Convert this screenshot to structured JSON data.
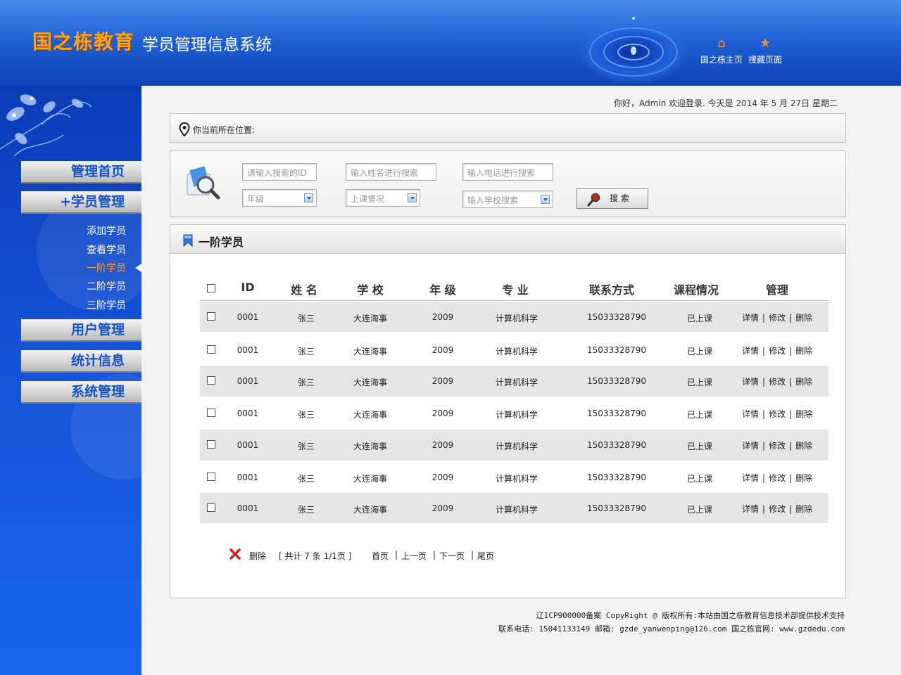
{
  "header": {
    "logo": "国之栋教育",
    "system_title": "学员管理信息系统",
    "links": [
      {
        "label": "国之栋主页",
        "icon": "home-icon"
      },
      {
        "label": "搜藏页面",
        "icon": "star-icon"
      }
    ]
  },
  "sidebar": {
    "menus": [
      {
        "label": "管理首页"
      },
      {
        "label": "+学员管理"
      },
      {
        "label": "用户管理"
      },
      {
        "label": "统计信息"
      },
      {
        "label": "系统管理"
      }
    ],
    "sub_items": [
      {
        "label": "添加学员",
        "active": false
      },
      {
        "label": "查看学员",
        "active": false
      },
      {
        "label": "一阶学员",
        "active": true
      },
      {
        "label": "二阶学员",
        "active": false
      },
      {
        "label": "三阶学员",
        "active": false
      }
    ]
  },
  "greeting": "你好，Admin 欢迎登录. 今天是  2014 年 5 月 27日 星期二",
  "location": {
    "label": "你当前所在位置:"
  },
  "search": {
    "id_placeholder": "请输入搜索的ID",
    "name_placeholder": "输入姓名进行搜索",
    "phone_placeholder": "输入电话进行搜索",
    "grade_select": "年级",
    "class_select": "上课情况",
    "school_select": "输入学校搜索",
    "button_label": "搜 索"
  },
  "list": {
    "title": "一阶学员",
    "columns": [
      "ID",
      "姓 名",
      "学 校",
      "年 级",
      "专 业",
      "联系方式",
      "课程情况",
      "管理"
    ],
    "rows": [
      {
        "id": "0001",
        "name": "张三",
        "school": "大连海事",
        "grade": "2009",
        "major": "计算机科学",
        "phone": "15033328790",
        "status": "已上课"
      },
      {
        "id": "0001",
        "name": "张三",
        "school": "大连海事",
        "grade": "2009",
        "major": "计算机科学",
        "phone": "15033328790",
        "status": "已上课"
      },
      {
        "id": "0001",
        "name": "张三",
        "school": "大连海事",
        "grade": "2009",
        "major": "计算机科学",
        "phone": "15033328790",
        "status": "已上课"
      },
      {
        "id": "0001",
        "name": "张三",
        "school": "大连海事",
        "grade": "2009",
        "major": "计算机科学",
        "phone": "15033328790",
        "status": "已上课"
      },
      {
        "id": "0001",
        "name": "张三",
        "school": "大连海事",
        "grade": "2009",
        "major": "计算机科学",
        "phone": "15033328790",
        "status": "已上课"
      },
      {
        "id": "0001",
        "name": "张三",
        "school": "大连海事",
        "grade": "2009",
        "major": "计算机科学",
        "phone": "15033328790",
        "status": "已上课"
      },
      {
        "id": "0001",
        "name": "张三",
        "school": "大连海事",
        "grade": "2009",
        "major": "计算机科学",
        "phone": "15033328790",
        "status": "已上课"
      }
    ],
    "actions": [
      "详情",
      "修改",
      "删除"
    ]
  },
  "pager": {
    "delete_label": "删除",
    "info": "[ 共计 7 条  1/1页 ]",
    "first": "首页",
    "prev": "上一页",
    "next": "下一页",
    "last": "尾页"
  },
  "footer": {
    "line1": "辽ICP900000备案  CopyRight @ 版权所有:本站由国之栋教育信息技术部提供技术支持",
    "line2": "联系电话: 15041133149 邮箱: gzde_yanwenping@126.com 国之栋官网: www.gzdedu.com"
  },
  "colors": {
    "brand_blue": "#1452d6",
    "logo_orange": "#ffa01a",
    "active_menu": "#ff9a2a"
  }
}
